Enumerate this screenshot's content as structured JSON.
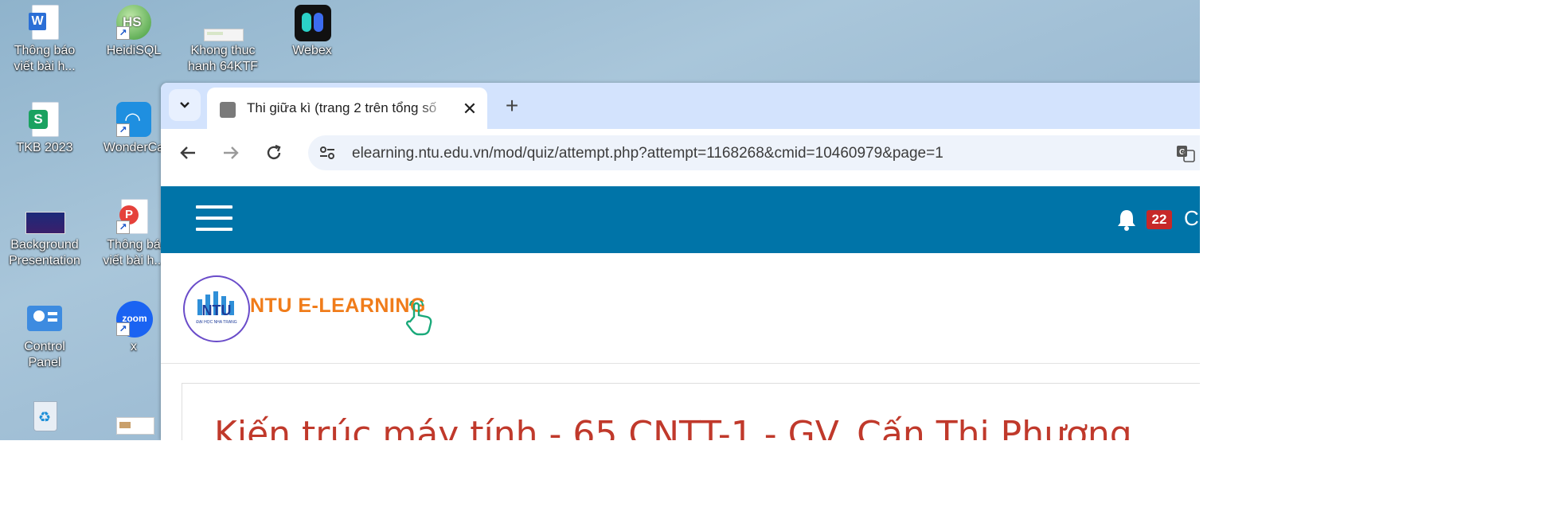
{
  "desktop": {
    "icons": [
      {
        "label": "Thông báo\nviết bài h...",
        "icon": "word-document-icon"
      },
      {
        "label": "HeidiSQL",
        "icon": "heidisql-icon"
      },
      {
        "label": "Khong thuc\nhanh 64KTF",
        "icon": "document-thumbnail-icon"
      },
      {
        "label": "Webex",
        "icon": "webex-icon"
      },
      {
        "label": "TKB 2023",
        "icon": "spreadsheet-icon"
      },
      {
        "label": "WonderCa",
        "icon": "wondercast-icon"
      },
      {
        "label": "Background\nPresentation",
        "icon": "presentation-thumbnail-icon"
      },
      {
        "label": "Thông bá\nviết bài h...",
        "icon": "pdf-icon"
      },
      {
        "label": "Control Panel",
        "icon": "control-panel-icon"
      },
      {
        "label": "x",
        "icon": "zoom-icon"
      },
      {
        "label": "",
        "icon": "recycle-bin-icon"
      },
      {
        "label": "",
        "icon": "file-thumbnail-icon"
      }
    ]
  },
  "browser": {
    "tab": {
      "title": "Thi giữa kì (trang 2 trên tổng số",
      "close": "✕"
    },
    "new_tab": "+",
    "url": "elearning.ntu.edu.vn/mod/quiz/attempt.php?attempt=1168268&cmid=10460979&page=1"
  },
  "page": {
    "notification_count": "22",
    "user_initial": "C",
    "logo_seal_text": "NTU",
    "logo_seal_caption": "ĐẠI HỌC NHA TRANG",
    "logo_text": "NTU E-LEARNING",
    "course_title": "Kiến trúc máy tính - 65 CNTT-1 - GV. Cấn Thị Phượng",
    "colors": {
      "header": "#0074a8",
      "badge": "#c62828",
      "title": "#c0392b",
      "logo": "#f07c1a"
    }
  }
}
